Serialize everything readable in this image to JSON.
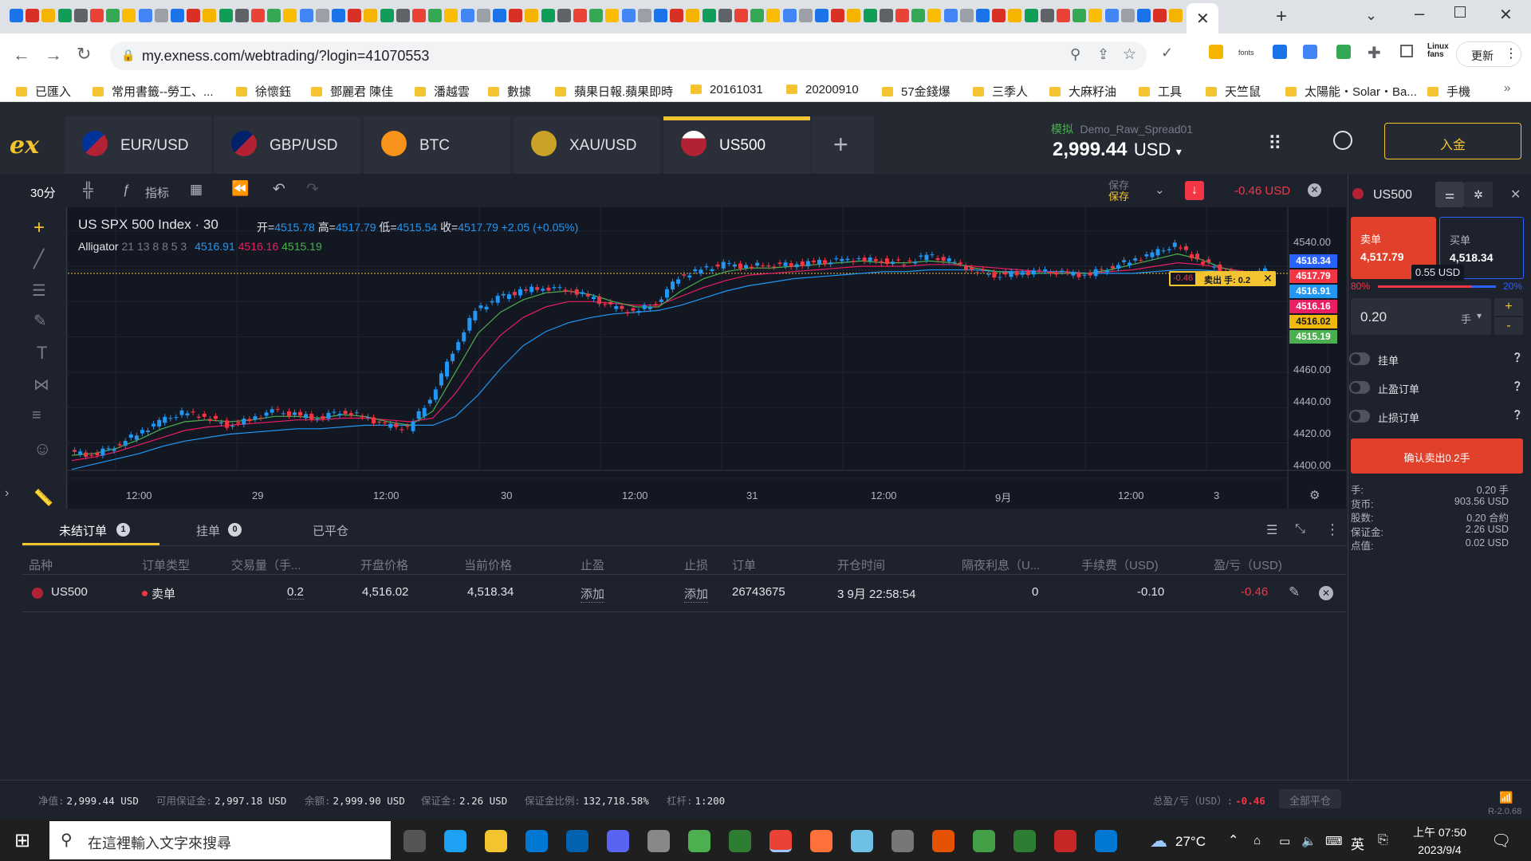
{
  "browser": {
    "url": "my.exness.com/webtrading/?login=41070553",
    "update_btn": "更新",
    "bookmarks": [
      "已匯入",
      "常用書籤--勞工、...",
      "徐懷鈺",
      "鄧麗君 陳佳",
      "潘越雲",
      "數據",
      "蘋果日報.蘋果即時",
      "20161031",
      "20200910",
      "57金錢爆",
      "三季人",
      "大麻籽油",
      "工具",
      "天竺鼠",
      "太陽能・Solar・Ba...",
      "手機"
    ]
  },
  "app": {
    "logo": "ex",
    "instrument_tabs": [
      {
        "label": "EUR/USD",
        "icon": "eu-us-flag-icon"
      },
      {
        "label": "GBP/USD",
        "icon": "gb-us-flag-icon"
      },
      {
        "label": "BTC",
        "icon": "bitcoin-icon"
      },
      {
        "label": "XAU/USD",
        "icon": "gold-icon"
      },
      {
        "label": "US500",
        "icon": "us500-flag-icon"
      }
    ],
    "account": {
      "mode": "模拟",
      "name": "Demo_Raw_Spread01",
      "balance": "2,999.44",
      "currency": "USD"
    },
    "deposit_btn": "入金"
  },
  "chart_toolbar": {
    "timeframe": "30分",
    "indicators": "指标",
    "save_top": "保存",
    "save_bottom": "保存",
    "pnl": "-0.46 USD"
  },
  "chart": {
    "title": "US SPX 500 Index · 30",
    "ohlc": {
      "o_label": "开=",
      "o": "4515.78",
      "h_label": "高=",
      "h": "4517.79",
      "l_label": "低=",
      "l": "4515.54",
      "c_label": "收=",
      "c": "4517.79",
      "change": "+2.05 (+0.05%)"
    },
    "alligator": {
      "label": "Alligator",
      "params": "21 13 8 8 5 3",
      "jaw": "4516.91",
      "teeth": "4516.16",
      "lips": "4515.19"
    },
    "position_tag": {
      "pnl": "-0.46",
      "label": "卖出 手: 0.2"
    },
    "price_tags": [
      {
        "value": "4518.34",
        "color": "#2962ff"
      },
      {
        "value": "4517.79",
        "color": "#f23645"
      },
      {
        "value": "4516.91",
        "color": "#2196f3"
      },
      {
        "value": "4516.16",
        "color": "#e91e63"
      },
      {
        "value": "4516.02",
        "color": "#f0b90b"
      },
      {
        "value": "4515.19",
        "color": "#4caf50"
      }
    ],
    "y_ticks": [
      "4540.00",
      "4460.00",
      "4440.00",
      "4420.00",
      "4400.00"
    ],
    "x_ticks": [
      "12:00",
      "29",
      "12:00",
      "30",
      "12:00",
      "31",
      "12:00",
      "9月",
      "12:00",
      "3"
    ]
  },
  "chart_data": {
    "type": "line",
    "title": "US SPX 500 Index · 30",
    "ylim": [
      4390,
      4548
    ],
    "series": [
      {
        "name": "price",
        "values": [
          4415,
          4413,
          4418,
          4425,
          4432,
          4437,
          4435,
          4430,
          4433,
          4438,
          4436,
          4434,
          4438,
          4435,
          4430,
          4428,
          4445,
          4472,
          4495,
          4502,
          4506,
          4508,
          4507,
          4503,
          4497,
          4494,
          4499,
          4514,
          4518,
          4521,
          4520,
          4521,
          4521,
          4522,
          4523,
          4524,
          4523,
          4522,
          4526,
          4523,
          4518,
          4515,
          4516,
          4517,
          4516,
          4515,
          4519,
          4523,
          4527,
          4532,
          4524,
          4518,
          4514,
          4517.79
        ]
      },
      {
        "name": "Alligator",
        "values": [
          4405,
          4408,
          4411,
          4414,
          4418,
          4421,
          4423,
          4425,
          4426,
          4427,
          4428,
          4428,
          4429,
          4430,
          4430,
          4430,
          4430,
          4435,
          4447,
          4462,
          4475,
          4483,
          4488,
          4491,
          4493,
          4494,
          4495,
          4498,
          4502,
          4506,
          4509,
          4511,
          4513,
          4514,
          4515,
          4516,
          4517,
          4517,
          4518,
          4518,
          4518,
          4517,
          4517,
          4517,
          4517,
          4516,
          4516,
          4516,
          4517,
          4518,
          4518,
          4517,
          4517,
          4516.91
        ]
      },
      {
        "name": "teeth",
        "values": [
          4410,
          4412,
          4415,
          4419,
          4423,
          4427,
          4429,
          4430,
          4431,
          4432,
          4433,
          4433,
          4434,
          4434,
          4433,
          4432,
          4434,
          4448,
          4466,
          4481,
          4491,
          4497,
          4500,
          4500,
          4499,
          4498,
          4498,
          4503,
          4508,
          4512,
          4515,
          4516,
          4517,
          4518,
          4519,
          4520,
          4520,
          4520,
          4521,
          4521,
          4520,
          4519,
          4518,
          4517,
          4516,
          4516,
          4517,
          4518,
          4520,
          4522,
          4521,
          4519,
          4517,
          4516.16
        ]
      },
      {
        "name": "lips",
        "values": [
          4413,
          4414,
          4417,
          4422,
          4428,
          4432,
          4433,
          4432,
          4433,
          4435,
          4435,
          4434,
          4436,
          4435,
          4432,
          4430,
          4438,
          4460,
          4482,
          4494,
          4501,
          4505,
          4506,
          4504,
          4500,
          4497,
          4497,
          4506,
          4513,
          4517,
          4519,
          4519,
          4520,
          4521,
          4522,
          4523,
          4522,
          4522,
          4523,
          4522,
          4519,
          4517,
          4516,
          4516,
          4516,
          4516,
          4518,
          4521,
          4524,
          4527,
          4524,
          4519,
          4516,
          4515.19
        ]
      }
    ]
  },
  "order_panel": {
    "symbol": "US500",
    "sell_label": "卖单",
    "sell_price": "4,517.79",
    "buy_label": "买单",
    "buy_price": "4,518.34",
    "spread": "0.55 USD",
    "sell_pct": "80%",
    "buy_pct": "20%",
    "volume": "0.20",
    "volume_unit": "手",
    "pending": "挂单",
    "take_profit": "止盈订单",
    "stop_loss": "止损订单",
    "confirm_btn": "确认卖出0.2手",
    "details": [
      {
        "k": "手:",
        "v": "0.20 手"
      },
      {
        "k": "货币:",
        "v": "903.56 USD"
      },
      {
        "k": "股数:",
        "v": "0.20 合約"
      },
      {
        "k": "保证金:",
        "v": "2.26 USD"
      },
      {
        "k": "点值:",
        "v": "0.02 USD"
      }
    ]
  },
  "orders": {
    "tabs": [
      {
        "label": "未结订单",
        "count": "1"
      },
      {
        "label": "挂单",
        "count": "0"
      },
      {
        "label": "已平仓",
        "count": ""
      }
    ],
    "columns": [
      "品种",
      "订单类型",
      "交易量（手...",
      "开盘价格",
      "当前价格",
      "止盈",
      "止损",
      "订单",
      "开仓时间",
      "隔夜利息（U...",
      "手续费（USD)",
      "盈/亏（USD)"
    ],
    "rows": [
      {
        "symbol": "US500",
        "type": "卖单",
        "volume": "0.2",
        "open": "4,516.02",
        "current": "4,518.34",
        "tp": "添加",
        "sl": "添加",
        "order": "26743675",
        "time": "3 9月 22:58:54",
        "swap": "0",
        "commission": "-0.10",
        "pnl": "-0.46"
      }
    ]
  },
  "status_bar": {
    "equity_label": "净值:",
    "equity": "2,999.44 USD",
    "free_margin_label": "可用保证金:",
    "free_margin": "2,997.18 USD",
    "balance_label": "余额:",
    "balance": "2,999.90 USD",
    "margin_label": "保证金:",
    "margin": "2.26 USD",
    "margin_level_label": "保证金比例:",
    "margin_level": "132,718.58%",
    "leverage_label": "杠杆:",
    "leverage": "1:200",
    "total_pnl_label": "总盈/亏（USD）:",
    "total_pnl": "-0.46",
    "close_all": "全部平仓",
    "version": "R-2.0.68"
  },
  "taskbar": {
    "search_placeholder": "在這裡輸入文字來搜尋",
    "weather": "27°C",
    "ime": "英",
    "time": "上午 07:50",
    "date": "2023/9/4"
  }
}
